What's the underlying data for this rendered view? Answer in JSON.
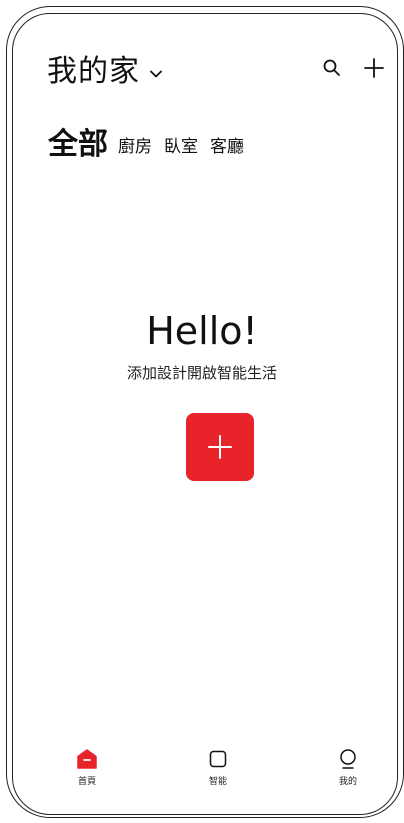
{
  "header": {
    "home_title": "我的家"
  },
  "tabs": [
    {
      "label": "全部",
      "active": true
    },
    {
      "label": "廚房",
      "active": false
    },
    {
      "label": "臥室",
      "active": false
    },
    {
      "label": "客廳",
      "active": false
    }
  ],
  "empty_state": {
    "greeting": "Hello!",
    "subtitle": "添加設計開啟智能生活"
  },
  "bottom_nav": {
    "items": [
      {
        "label": "首頁",
        "icon": "home-icon",
        "active": true
      },
      {
        "label": "智能",
        "icon": "square-icon",
        "active": false
      },
      {
        "label": "我的",
        "icon": "profile-icon",
        "active": false
      }
    ]
  },
  "colors": {
    "accent": "#e8232a",
    "text": "#111111",
    "background": "#ffffff"
  }
}
